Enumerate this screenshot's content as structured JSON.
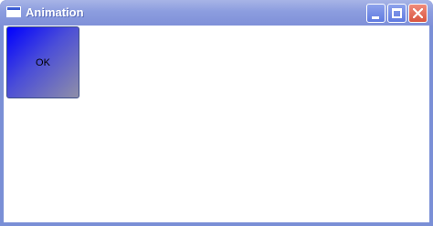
{
  "window": {
    "title": "Animation",
    "controls": [
      "minimize",
      "maximize",
      "close"
    ]
  },
  "content": {
    "button_label": "OK"
  },
  "colors": {
    "title_bar": "#8c9ddf",
    "button_gradient_start": "#0000ff",
    "button_gradient_end": "#8f8fa8"
  },
  "icons": {
    "app": "window-app-icon",
    "minimize": "minimize-icon",
    "maximize": "maximize-icon",
    "close": "close-icon"
  }
}
